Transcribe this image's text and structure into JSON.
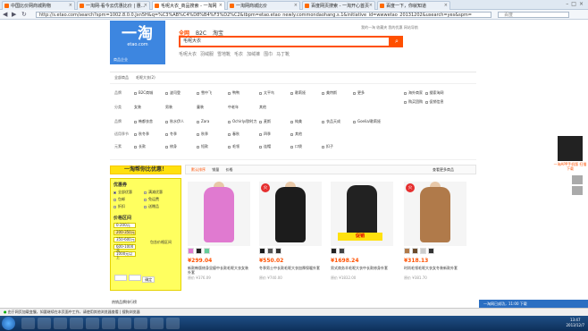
{
  "browser": {
    "tabs": [
      {
        "label": "中国比价网商城购物"
      },
      {
        "label": "一淘网-看今云优惠比价 | 惠..."
      },
      {
        "label": "毛呢大衣_商品搜索 - 一淘网"
      },
      {
        "label": "一淘网商城比价"
      },
      {
        "label": "百度网页搜索 - 一淘开心首页"
      },
      {
        "label": "百度一下，你就知道"
      }
    ],
    "url": "http://s.etao.com/search?spm=1002.8.0.0.Jxn5H&q=%C3%AB%C4%D8%B4%F3%D2%C2&tbpm=etao.etao_newly.commondaohang.s.1&initiative_id=wwwetao_20131202&usearch=yes&spm=",
    "search_placeholder": "百度"
  },
  "header": {
    "logo_text": "一淘",
    "logo_domain": "etao.com",
    "logo_sub": "商品企业",
    "search_tabs": [
      "全网",
      "B2C",
      "淘宝"
    ],
    "query": "毛呢大衣",
    "hot_words": [
      "毛呢大衣",
      "羽绒服",
      "雪地靴",
      "毛衣",
      "加绒裤",
      "围巾",
      "马丁靴"
    ],
    "top_links": "我的一淘  收藏夹  我的优惠  网站导航"
  },
  "filters": {
    "cats": [
      "全部商品",
      "毛呢大衣(2)"
    ],
    "rows": [
      {
        "label": "品牌",
        "items": [
          "B2C商城",
          "波司登",
          "雪中飞",
          "鸭鸭",
          "太平鸟",
          "歌莉娅",
          "美特斯",
          "更多"
        ]
      },
      {
        "label": "分类",
        "items": [
          "女装",
          "男装",
          "童装",
          "中老年",
          "其他"
        ]
      },
      {
        "label": "品牌",
        "items": [
          "韩都衣舍",
          "秋水伊人",
          "Zara",
          "Ochirly/欧时力",
          "麦斯",
          "纯美",
          "衣品天成",
          "Goelia/歌莉娅"
        ]
      },
      {
        "label": "适用季节",
        "items": [
          "秋冬季",
          "冬季",
          "秋季",
          "春秋",
          "四季",
          "其他"
        ]
      },
      {
        "label": "元素",
        "items": [
          "长款",
          "修身",
          "短款",
          "毛领",
          "连帽",
          "口袋",
          "扣子"
        ]
      }
    ],
    "right_options": [
      "海外商家",
      "搜索淘网",
      "购买团购",
      "促销信息"
    ]
  },
  "promo": {
    "title": "一淘帮你比优惠！",
    "section1": "优惠券",
    "items1": [
      "全部优惠",
      "满减优惠",
      "包邮",
      "免运费",
      "折扣",
      "送赠品"
    ],
    "section2": "价格区间",
    "prices": [
      "0-200元",
      "200-350元",
      "350-600元",
      "600-1000元",
      "1000元以上"
    ],
    "range_label": "包含价格区间",
    "confirm": "确定",
    "bottom": "热销品牌排行榜"
  },
  "toolbar": {
    "sort": [
      "默认排序",
      "销量",
      "价格"
    ],
    "view": "查看更多商品"
  },
  "products": [
    {
      "price": "¥299.04",
      "title": "新款韩版修身显瘦中长款毛呢大衣女装外套",
      "sub": "原价 ¥376.09"
    },
    {
      "price": "¥550.02",
      "title": "冬季男士中长款毛呢大衣加厚保暖外套",
      "sub": "原价 ¥740.00"
    },
    {
      "price": "¥1698.24",
      "title": "男式商务羊毛呢大衣中长款修身外套",
      "sub": "原价 ¥1832.00"
    },
    {
      "price": "¥318.13",
      "title": "时尚毛领毛呢大衣女冬装新款外套",
      "sub": "原价 ¥381.70"
    }
  ],
  "stamp_text": "火",
  "sale_tag": "促销",
  "qr": {
    "caption": "一淘APP手机版 扫描下载"
  },
  "notification": "一淘网已成功，11:00 下载",
  "status_bar": "由于网页加载变慢，如要继续在本页面中工作，请使用其他浏览器查看 | 搜狗浏览器",
  "clock": {
    "time": "13:47",
    "date": "2013/12/7"
  },
  "colors": {
    "accent": "#ff5000",
    "logo_bg": "#3d86e0",
    "promo": "#ffe10e"
  }
}
